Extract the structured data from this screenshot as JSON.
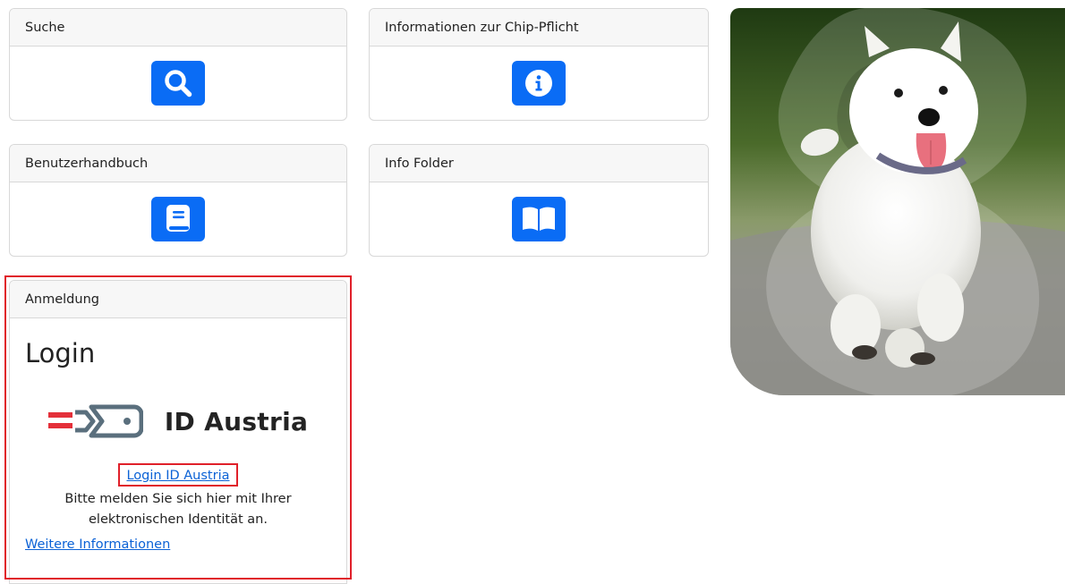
{
  "tiles": {
    "suche": {
      "title": "Suche",
      "icon": "search-icon"
    },
    "chip": {
      "title": "Informationen zur Chip-Pflicht",
      "icon": "info-icon"
    },
    "handbuch": {
      "title": "Benutzerhandbuch",
      "icon": "book-icon"
    },
    "folder": {
      "title": "Info Folder",
      "icon": "open-book-icon"
    }
  },
  "login": {
    "header": "Anmeldung",
    "heading": "Login",
    "logo_text": "ID Austria",
    "login_link": "Login ID Austria",
    "description": "Bitte melden Sie sich hier mit Ihrer elektronischen Identität an.",
    "more_info_link": "Weitere Informationen"
  },
  "colors": {
    "icon_blue": "#0a6cf5",
    "link_blue": "#0b62d6",
    "highlight_red": "#e0202a",
    "austria_red": "#e4303a",
    "logo_grey": "#5a6f7d"
  }
}
